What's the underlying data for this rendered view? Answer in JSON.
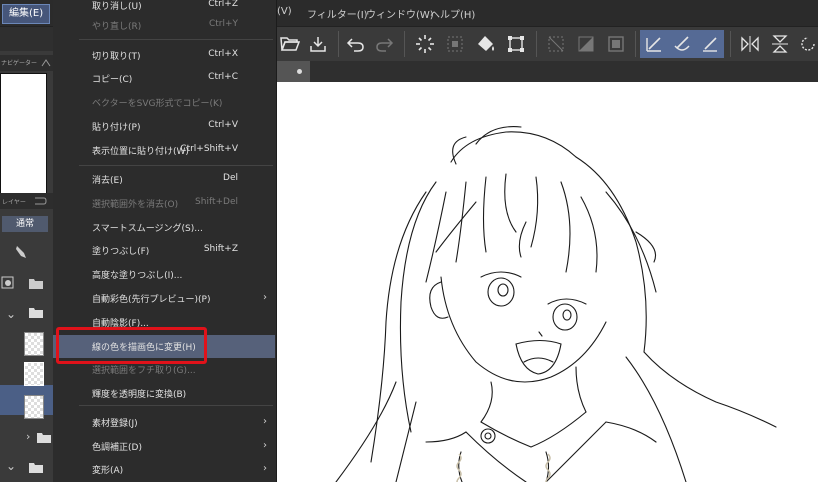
{
  "menubar": {
    "edit": "編集(E)",
    "view_tail": "(V)",
    "filter": "フィルター(I)",
    "window": "ウィンドウ(W)",
    "help": "ヘルプ(H)"
  },
  "left_panel": {
    "navigator_tab": "ナビゲーター",
    "layer_tab": "レイヤー",
    "blend_mode": "通常"
  },
  "edit_menu": {
    "items": [
      {
        "label": "取り消し(U)",
        "shortcut": "Ctrl+Z",
        "disabled": false
      },
      {
        "label": "やり直し(R)",
        "shortcut": "Ctrl+Y",
        "disabled": true
      },
      {
        "label": "切り取り(T)",
        "shortcut": "Ctrl+X",
        "disabled": false
      },
      {
        "label": "コピー(C)",
        "shortcut": "Ctrl+C",
        "disabled": false
      },
      {
        "label": "ベクターをSVG形式でコピー(K)",
        "shortcut": "",
        "disabled": true
      },
      {
        "label": "貼り付け(P)",
        "shortcut": "Ctrl+V",
        "disabled": false
      },
      {
        "label": "表示位置に貼り付け(W)",
        "shortcut": "Ctrl+Shift+V",
        "disabled": false
      },
      {
        "label": "消去(E)",
        "shortcut": "Del",
        "disabled": false
      },
      {
        "label": "選択範囲外を消去(O)",
        "shortcut": "Shift+Del",
        "disabled": true
      },
      {
        "label": "スマートスムージング(S)...",
        "shortcut": "",
        "disabled": false
      },
      {
        "label": "塗りつぶし(F)",
        "shortcut": "Shift+Z",
        "disabled": false
      },
      {
        "label": "高度な塗りつぶし(I)...",
        "shortcut": "",
        "disabled": false
      },
      {
        "label": "自動彩色(先行プレビュー)(P)",
        "shortcut": "",
        "disabled": false
      },
      {
        "label": "自動陰影(F)...",
        "shortcut": "",
        "disabled": false
      },
      {
        "label": "線の色を描画色に変更(H)",
        "shortcut": "",
        "disabled": false
      },
      {
        "label": "選択範囲をフチ取り(G)...",
        "shortcut": "",
        "disabled": true
      },
      {
        "label": "輝度を透明度に変換(B)",
        "shortcut": "",
        "disabled": false
      },
      {
        "label": "素材登録(J)",
        "shortcut": "",
        "disabled": false
      },
      {
        "label": "色調補正(D)",
        "shortcut": "",
        "disabled": false
      },
      {
        "label": "変形(A)",
        "shortcut": "",
        "disabled": false
      }
    ]
  },
  "toolbar": {
    "icons": [
      "folder-open-icon",
      "save-icon",
      "undo-icon",
      "redo-icon",
      "clear-icon",
      "clear-outside-icon",
      "fill-icon",
      "transform-icon",
      "deselect-icon",
      "invert-selection-icon",
      "show-selection-icon",
      "snap-ruler-icon",
      "snap-special-ruler-icon",
      "snap-grid-icon",
      "flip-horizontal-icon",
      "flip-vertical-icon",
      "rotate-icon"
    ]
  },
  "colors": {
    "accent_highlight": "#56617a",
    "annotation_red": "#e0121a",
    "active_tool": "#556a95"
  }
}
